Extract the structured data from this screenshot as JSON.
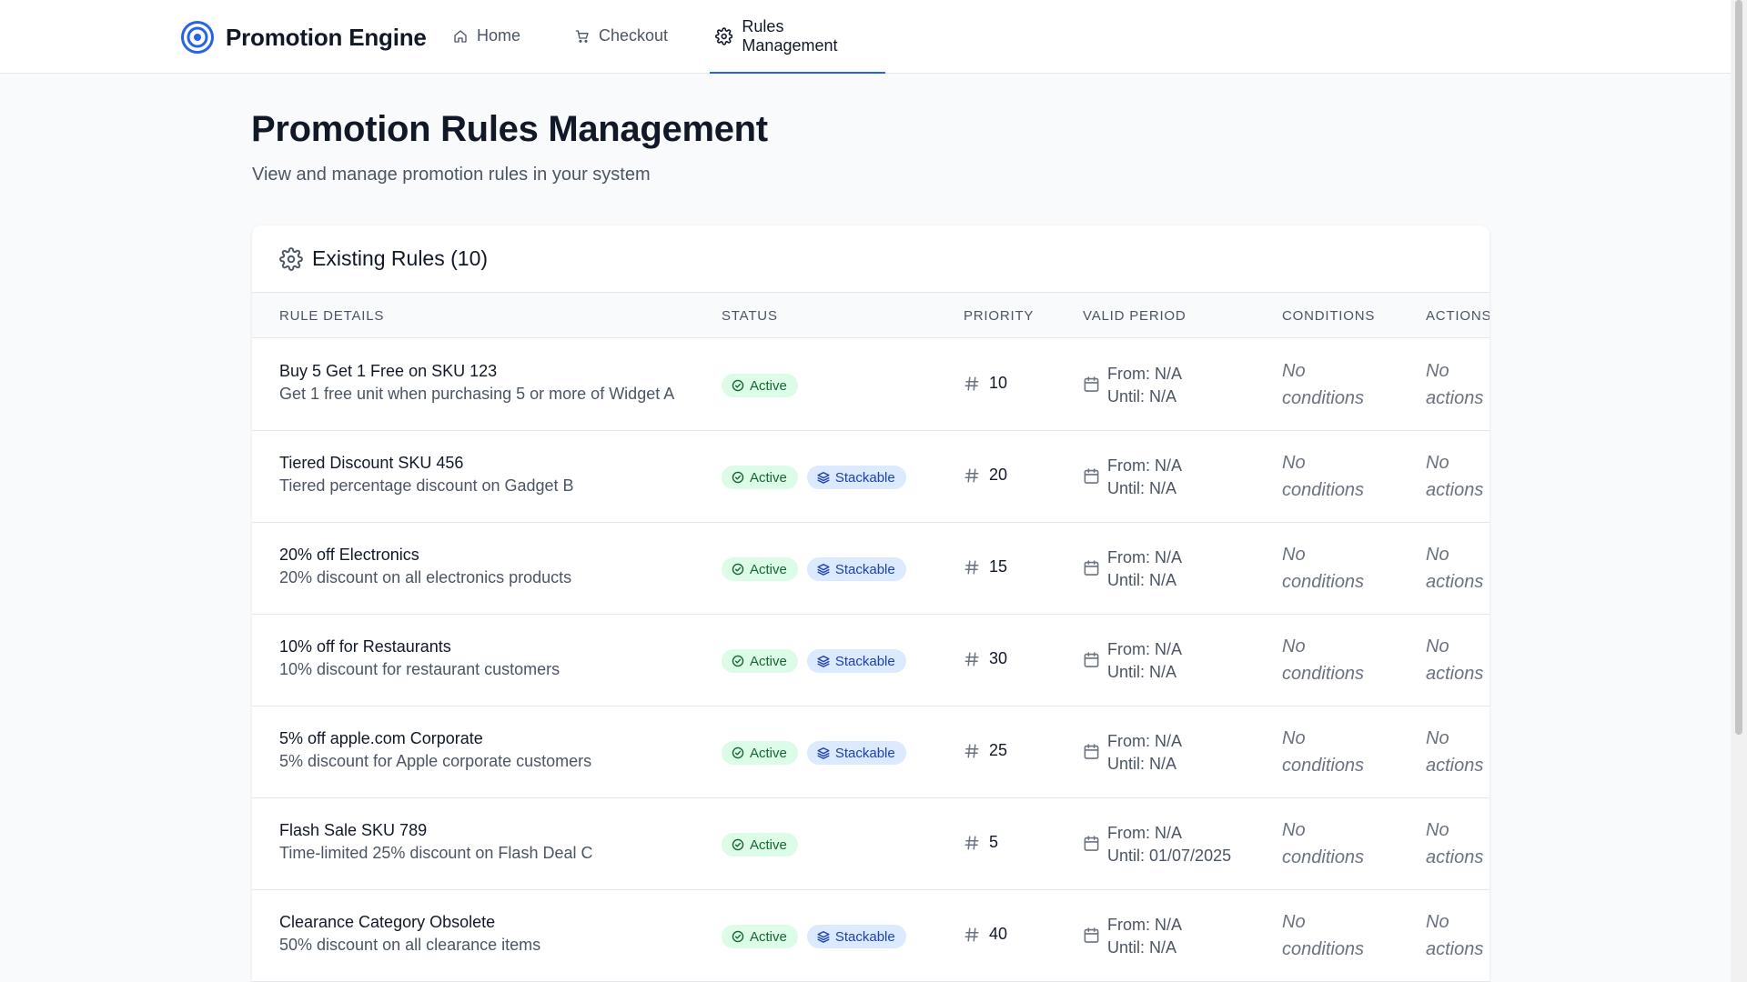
{
  "app": {
    "name": "Promotion Engine"
  },
  "nav": {
    "home": "Home",
    "checkout": "Checkout",
    "rules": "Rules Management"
  },
  "page": {
    "title": "Promotion Rules Management",
    "subtitle": "View and manage promotion rules in your system"
  },
  "card": {
    "title": "Existing Rules (10)"
  },
  "columns": {
    "details": "Rule Details",
    "status": "Status",
    "priority": "Priority",
    "period": "Valid Period",
    "conditions": "Conditions",
    "actions": "Actions"
  },
  "labels": {
    "active": "Active",
    "stackable": "Stackable",
    "no": "No",
    "conditions": "conditions",
    "actions": "actions"
  },
  "rules": [
    {
      "name": "Buy 5 Get 1 Free on SKU 123",
      "desc": "Get 1 free unit when purchasing 5 or more of Widget A",
      "active": true,
      "stackable": false,
      "priority": "10",
      "from": "From: N/A",
      "until": "Until: N/A"
    },
    {
      "name": "Tiered Discount SKU 456",
      "desc": "Tiered percentage discount on Gadget B",
      "active": true,
      "stackable": true,
      "priority": "20",
      "from": "From: N/A",
      "until": "Until: N/A"
    },
    {
      "name": "20% off Electronics",
      "desc": "20% discount on all electronics products",
      "active": true,
      "stackable": true,
      "priority": "15",
      "from": "From: N/A",
      "until": "Until: N/A"
    },
    {
      "name": "10% off for Restaurants",
      "desc": "10% discount for restaurant customers",
      "active": true,
      "stackable": true,
      "priority": "30",
      "from": "From: N/A",
      "until": "Until: N/A"
    },
    {
      "name": "5% off apple.com Corporate",
      "desc": "5% discount for Apple corporate customers",
      "active": true,
      "stackable": true,
      "priority": "25",
      "from": "From: N/A",
      "until": "Until: N/A"
    },
    {
      "name": "Flash Sale SKU 789",
      "desc": "Time-limited 25% discount on Flash Deal C",
      "active": true,
      "stackable": false,
      "priority": "5",
      "from": "From: N/A",
      "until": "Until: 01/07/2025"
    },
    {
      "name": "Clearance Category Obsolete",
      "desc": "50% discount on all clearance items",
      "active": true,
      "stackable": true,
      "priority": "40",
      "from": "From: N/A",
      "until": "Until: N/A"
    }
  ],
  "colors": {
    "accent": "#2563eb",
    "active_bg": "#dcfce7",
    "active_fg": "#166534",
    "stack_bg": "#dbeafe",
    "stack_fg": "#1e40af"
  }
}
